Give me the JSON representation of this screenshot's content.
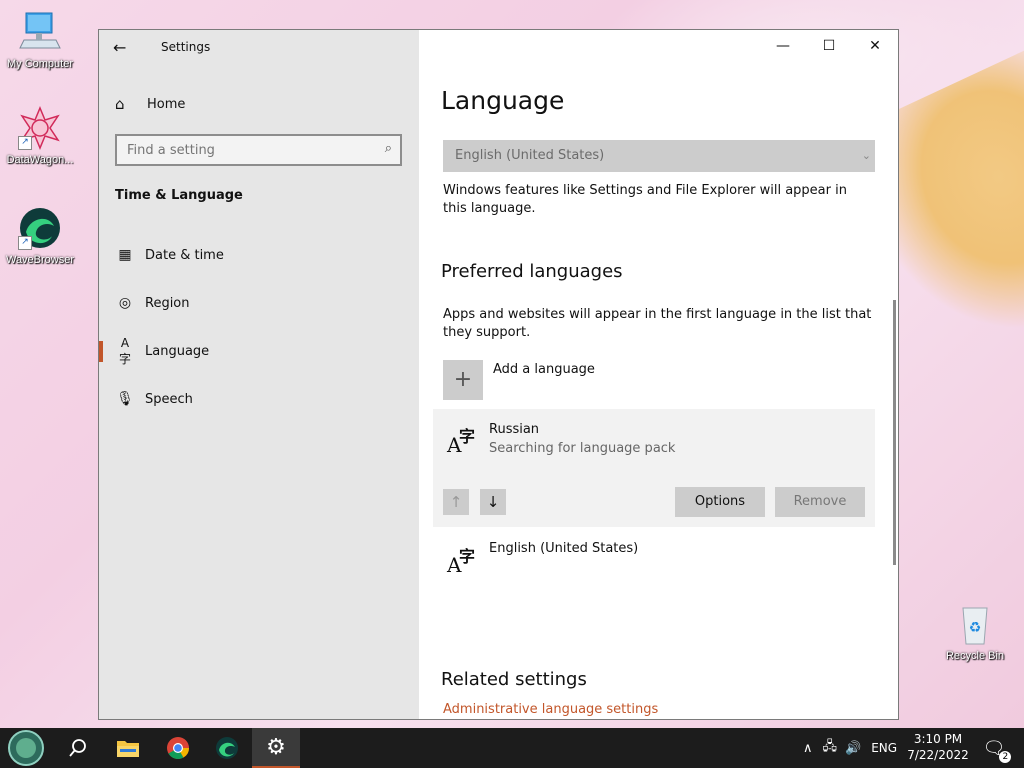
{
  "desktop": {
    "icons": [
      {
        "label": "My Computer",
        "icon": "computer-icon"
      },
      {
        "label": "DataWagon...",
        "icon": "datawagon-icon"
      },
      {
        "label": "WaveBrowser",
        "icon": "wavebrowser-icon"
      },
      {
        "label": "Recycle Bin",
        "icon": "recycle-bin-icon"
      }
    ]
  },
  "window": {
    "title": "Settings",
    "controls": {
      "minimize": "—",
      "maximize": "☐",
      "close": "✕"
    }
  },
  "sidebar": {
    "home": "Home",
    "search_placeholder": "Find a setting",
    "section_title": "Time & Language",
    "items": [
      {
        "label": "Date & time",
        "icon": "calendar-clock-icon"
      },
      {
        "label": "Region",
        "icon": "globe-icon"
      },
      {
        "label": "Language",
        "icon": "language-icon",
        "active": true
      },
      {
        "label": "Speech",
        "icon": "microphone-icon"
      }
    ]
  },
  "main": {
    "title": "Language",
    "display_language": "English (United States)",
    "display_language_desc": "Windows features like Settings and File Explorer will appear in this language.",
    "preferred_title": "Preferred languages",
    "preferred_desc": "Apps and websites will appear in the first language in the list that they support.",
    "add_language": "Add a language",
    "languages": [
      {
        "name": "Russian",
        "status": "Searching for language pack"
      },
      {
        "name": "English (United States)",
        "status": ""
      }
    ],
    "options_button": "Options",
    "remove_button": "Remove",
    "related_title": "Related settings",
    "related_link": "Administrative language settings"
  },
  "taskbar": {
    "lang": "ENG",
    "time": "3:10 PM",
    "date": "7/22/2022",
    "notification_count": "2"
  },
  "colors": {
    "accent": "#c2562a",
    "link": "#c2562a"
  }
}
